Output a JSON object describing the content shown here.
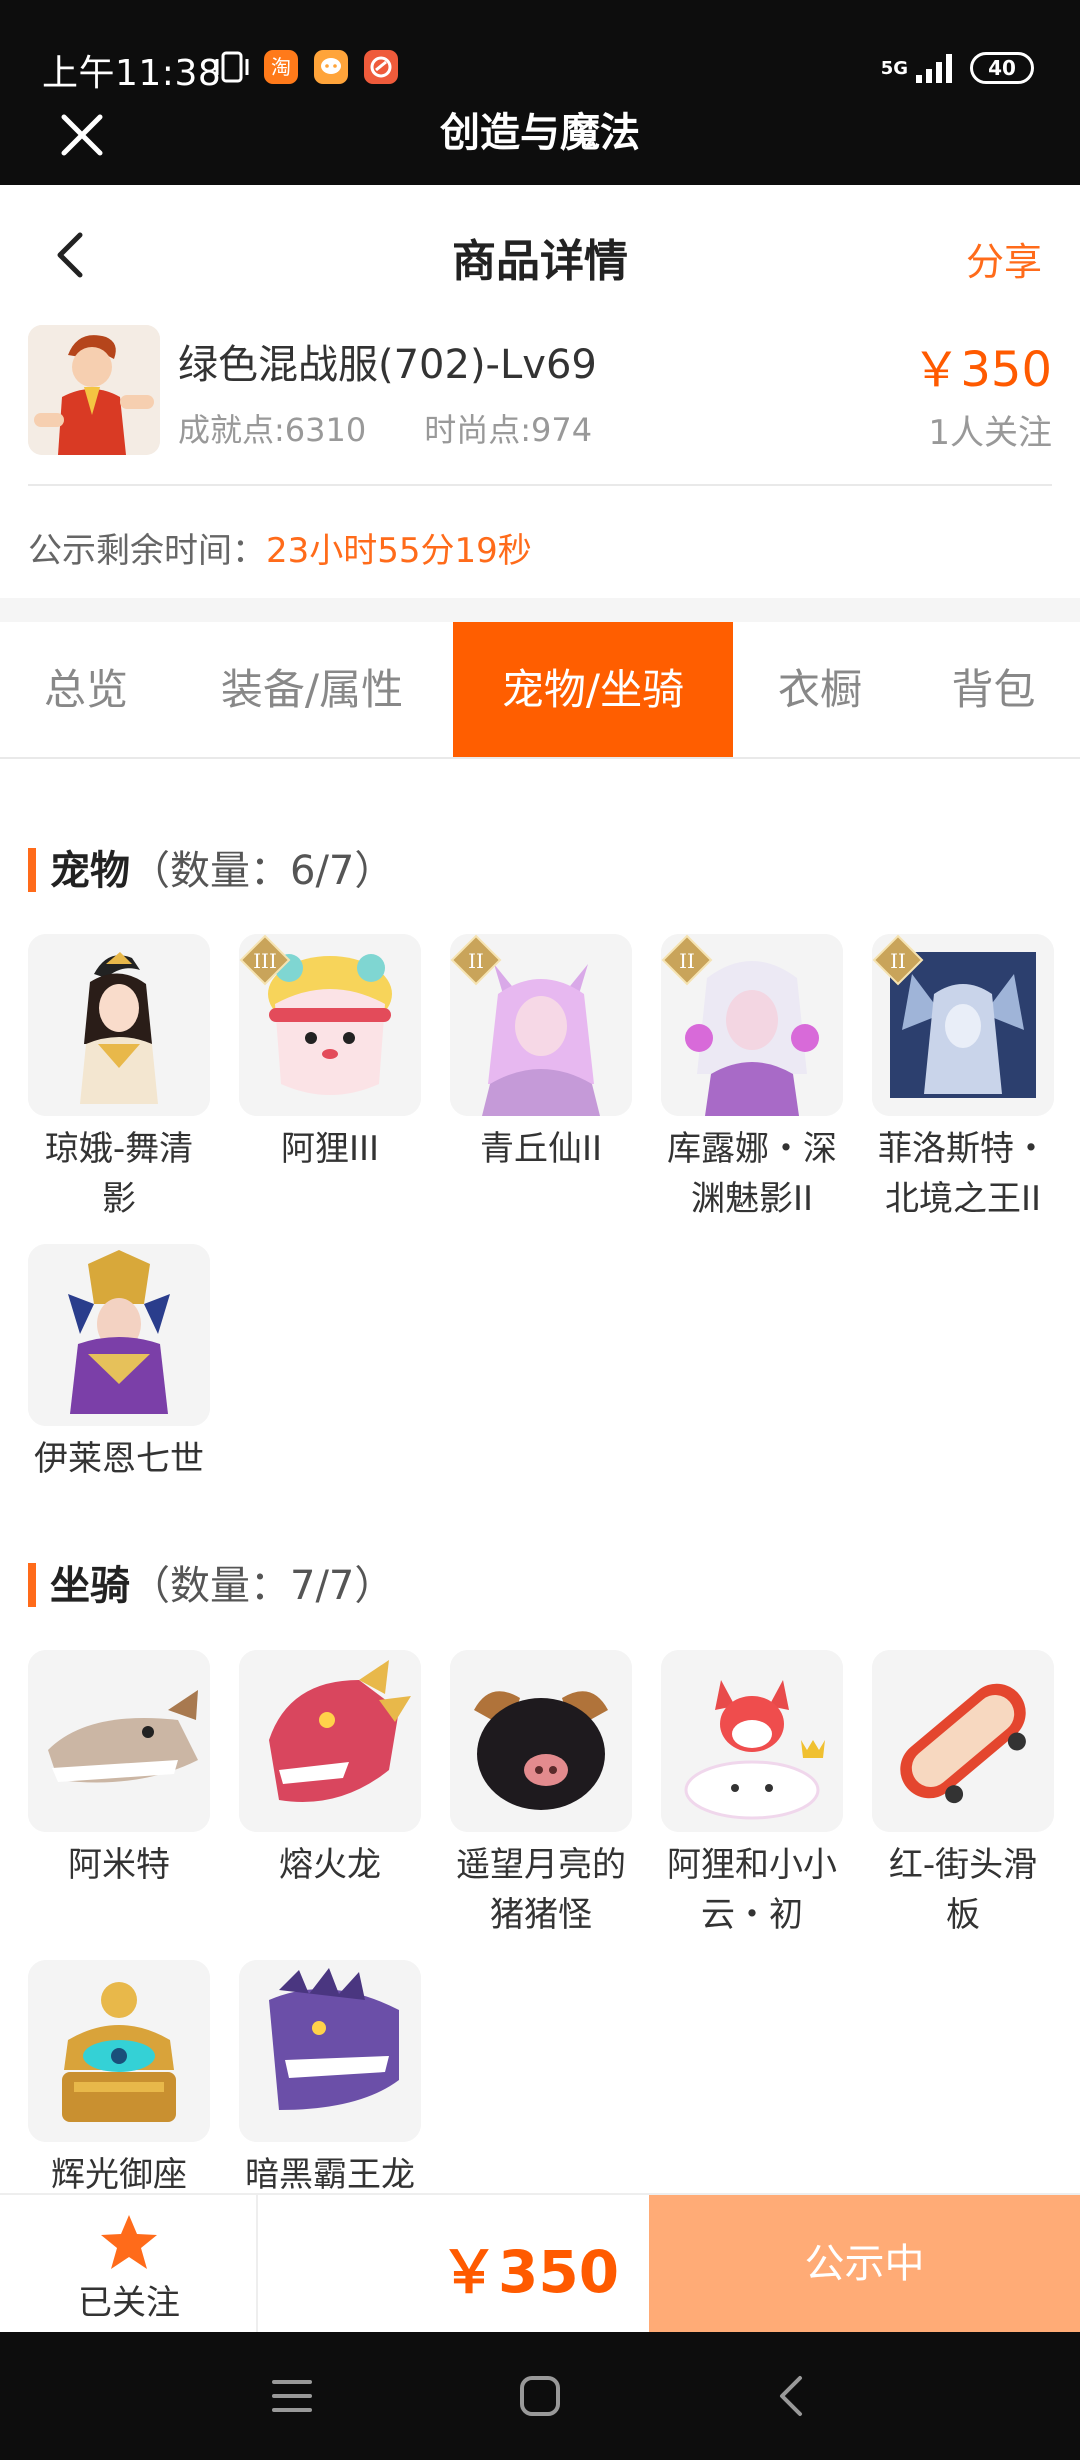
{
  "status_bar": {
    "time": "上午11:38",
    "network": "5G",
    "battery": "40",
    "app_badges": [
      "淘",
      "",
      ""
    ]
  },
  "webview": {
    "title": "创造与魔法"
  },
  "header": {
    "title": "商品详情",
    "share_label": "分享"
  },
  "product": {
    "name": "绿色混战服(702)-Lv69",
    "achievement": "成就点:6310",
    "fashion": "时尚点:974",
    "price": "￥350",
    "followers": "1人关注"
  },
  "notice": {
    "label": "公示剩余时间：",
    "countdown": "23小时55分19秒"
  },
  "tabs": [
    {
      "label": "总览",
      "active": false
    },
    {
      "label": "装备/属性",
      "active": false
    },
    {
      "label": "宠物/坐骑",
      "active": true
    },
    {
      "label": "衣橱",
      "active": false
    },
    {
      "label": "背包",
      "active": false
    }
  ],
  "pets": {
    "title": "宠物",
    "count": "（数量：6/7）",
    "items": [
      {
        "name": "琼娥-舞清影",
        "badge": ""
      },
      {
        "name": "阿狸III",
        "badge": "III"
      },
      {
        "name": "青丘仙II",
        "badge": "II"
      },
      {
        "name": "库露娜・深渊魅影II",
        "badge": "II"
      },
      {
        "name": "菲洛斯特・北境之王II",
        "badge": "II"
      },
      {
        "name": "伊莱恩七世",
        "badge": ""
      }
    ]
  },
  "mounts": {
    "title": "坐骑",
    "count": "（数量：7/7）",
    "items": [
      {
        "name": "阿米特"
      },
      {
        "name": "熔火龙"
      },
      {
        "name": "遥望月亮的猪猪怪"
      },
      {
        "name": "阿狸和小小云・初"
      },
      {
        "name": "红-街头滑板"
      },
      {
        "name": "辉光御座"
      },
      {
        "name": "暗黑霸王龙"
      }
    ]
  },
  "bottom_bar": {
    "follow_label": "已关注",
    "price": "￥350",
    "status_button": "公示中"
  },
  "colors": {
    "accent": "#ff5e00",
    "accent_light": "#ffab76",
    "dark_bar": "#0d0d0d"
  }
}
